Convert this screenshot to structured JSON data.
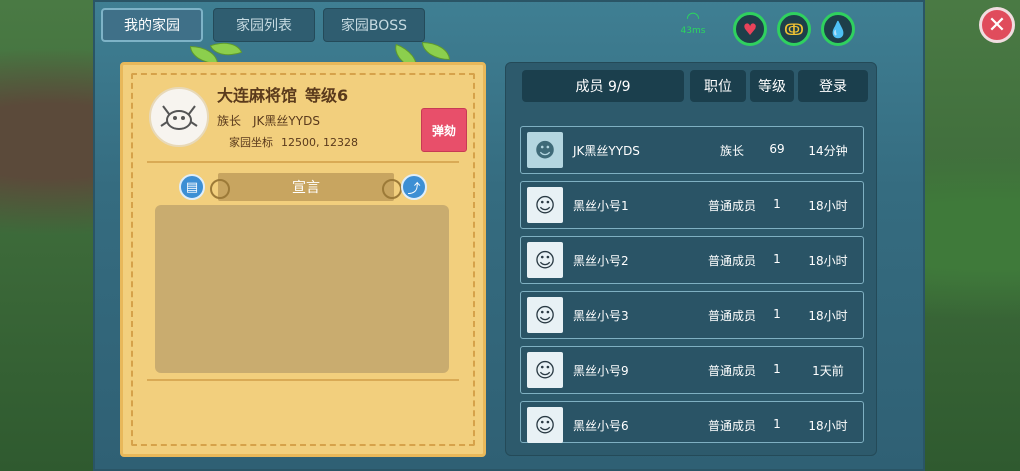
{
  "tabs": [
    {
      "label": "我的家园",
      "active": true
    },
    {
      "label": "家园列表",
      "active": false
    },
    {
      "label": "家园BOSS",
      "active": false
    }
  ],
  "status": {
    "ping": "43ms",
    "icons": [
      "heart-icon",
      "arm-strength-icon",
      "water-drop-icon"
    ],
    "close": "✕"
  },
  "home": {
    "name": "大连麻将馆",
    "level": "等级6",
    "leader_label": "族长",
    "leader_name": "JK黑丝YYDS",
    "coords_label": "家园坐标",
    "coords": "12500, 12328",
    "impeach_label": "弹劾",
    "declaration_title": "宣言",
    "declaration_text": ""
  },
  "members": {
    "count_label": "成员 9/9",
    "col_role": "职位",
    "col_level": "等级",
    "col_login": "登录",
    "rows": [
      {
        "name": "JK黑丝YYDS",
        "role": "族长",
        "level": "69",
        "login": "14分钟"
      },
      {
        "name": "黑丝小号1",
        "role": "普通成员",
        "level": "1",
        "login": "18小时"
      },
      {
        "name": "黑丝小号2",
        "role": "普通成员",
        "level": "1",
        "login": "18小时"
      },
      {
        "name": "黑丝小号3",
        "role": "普通成员",
        "level": "1",
        "login": "18小时"
      },
      {
        "name": "黑丝小号9",
        "role": "普通成员",
        "level": "1",
        "login": "1天前"
      },
      {
        "name": "黑丝小号6",
        "role": "普通成员",
        "level": "1",
        "login": "18小时"
      }
    ]
  }
}
